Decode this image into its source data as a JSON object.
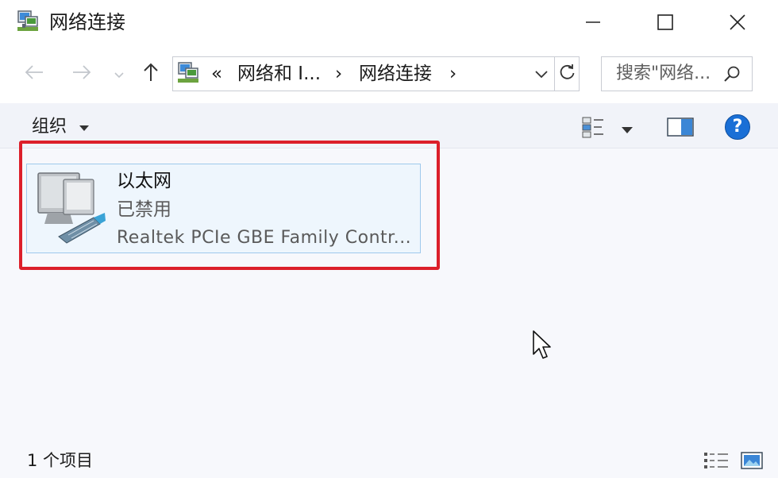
{
  "window": {
    "title": "网络连接",
    "controls": {
      "minimize": "minimize-icon",
      "maximize": "maximize-icon",
      "close": "close-icon"
    }
  },
  "navigation": {
    "back_icon": "arrow-left-icon",
    "forward_icon": "arrow-right-icon",
    "recent_icon": "chevron-down-icon",
    "up_icon": "arrow-up-icon",
    "address": {
      "overflow": "«",
      "crumbs": [
        "网络和 I...",
        "网络连接"
      ],
      "separator": "›",
      "dropdown_icon": "chevron-down-icon",
      "refresh_icon": "refresh-icon"
    },
    "search": {
      "placeholder": "搜索\"网络...",
      "icon": "search-icon"
    }
  },
  "commandbar": {
    "organize_label": "组织",
    "view_options_icon": "change-view-icon",
    "preview_pane_icon": "preview-pane-icon",
    "help_icon": "help-icon",
    "help_glyph": "?"
  },
  "items": [
    {
      "name": "以太网",
      "status": "已禁用",
      "adapter": "Realtek PCIe GBE Family Contr...",
      "icon": "network-adapter-icon"
    }
  ],
  "statusbar": {
    "count": "1 个项目",
    "details_view_icon": "details-view-icon",
    "large_icons_view_icon": "large-icons-view-icon"
  },
  "colors": {
    "highlight_box": "#dc1f2a",
    "selection_fill": "#eef6fd",
    "selection_border": "#9fc9ec",
    "help_blue": "#1a6fd6"
  }
}
